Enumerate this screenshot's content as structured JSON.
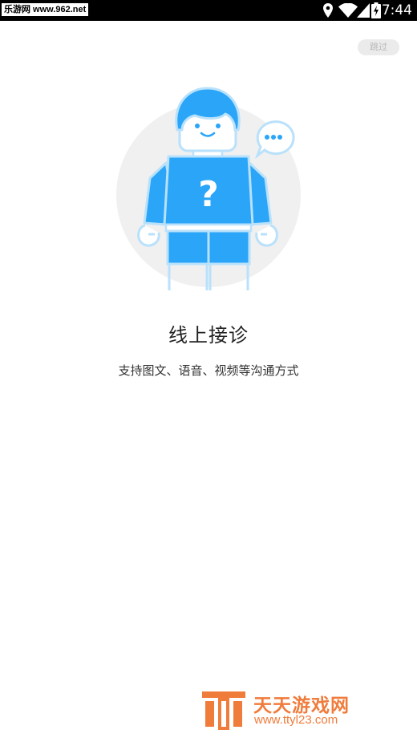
{
  "status_bar": {
    "carrier_watermark": "乐游网 www.962.net",
    "time": "7:44",
    "icons": [
      "location-icon",
      "wifi-icon",
      "signal-icon",
      "battery-charging-icon"
    ]
  },
  "skip_button": {
    "label": "跳过"
  },
  "onboarding": {
    "illustration": "figure-question-mark-icon",
    "title": "线上接诊",
    "subtitle": "支持图文、语音、视频等沟通方式"
  },
  "site_watermark": {
    "name": "天天游戏网",
    "url": "www.ttyl23.com"
  },
  "colors": {
    "accent_blue": "#2aa5f8",
    "outline_blue": "#b9e1fb",
    "watermark_orange": "#f07c3c"
  }
}
